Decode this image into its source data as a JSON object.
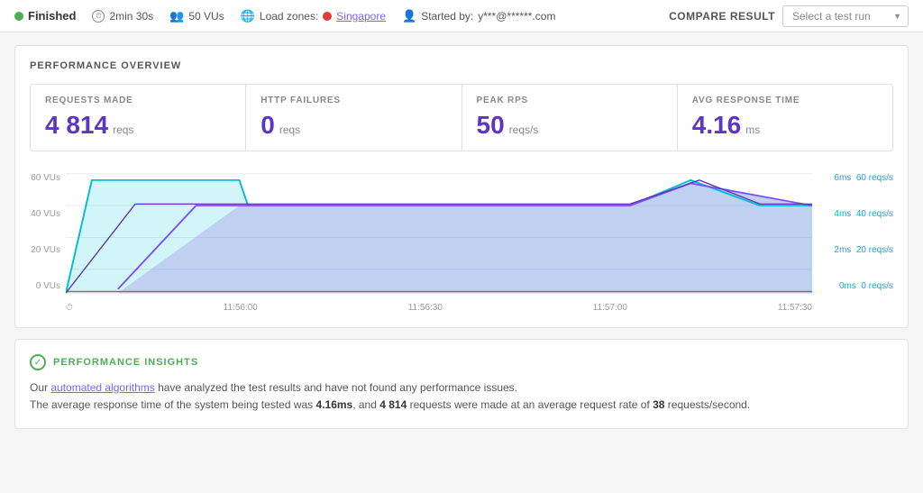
{
  "header": {
    "status": "Finished",
    "duration": "2min 30s",
    "vus": "50 VUs",
    "load_zones_label": "Load zones:",
    "location": "Singapore",
    "started_by_label": "Started by:",
    "started_by_email": "y***@******.com",
    "compare_label": "COMPARE RESULT",
    "select_placeholder": "Select a test run"
  },
  "performance_overview": {
    "title": "PERFORMANCE OVERVIEW",
    "metrics": [
      {
        "label": "REQUESTS MADE",
        "value": "4 814",
        "unit": "reqs"
      },
      {
        "label": "HTTP FAILURES",
        "value": "0",
        "unit": "reqs"
      },
      {
        "label": "PEAK RPS",
        "value": "50",
        "unit": "reqs/s"
      },
      {
        "label": "AVG RESPONSE TIME",
        "value": "4.16",
        "unit": "ms"
      }
    ]
  },
  "chart": {
    "y_left_labels": [
      "60 VUs",
      "40 VUs",
      "20 VUs",
      "0 VUs"
    ],
    "y_right_labels": [
      "6ms  60 reqs/s",
      "4ms  40 reqs/s",
      "2ms  20 reqs/s",
      "0ms  0 reqs/s"
    ],
    "x_labels": [
      "11:56:00",
      "11:56:30",
      "11:57:00",
      "11:57:30"
    ]
  },
  "performance_insights": {
    "title": "PERFORMANCE INSIGHTS",
    "text1": "Our ",
    "text1_link": "automated algorithms",
    "text1_cont": " have analyzed the test results and have not found any performance issues.",
    "text2_pre": "The average response time of the system being tested was ",
    "avg_response": "4.16ms",
    "text2_mid": ", and ",
    "requests_bold": "4 814",
    "text2_cont": " requests were made at an average request rate of ",
    "rate_bold": "38",
    "text2_end": " requests/second."
  }
}
